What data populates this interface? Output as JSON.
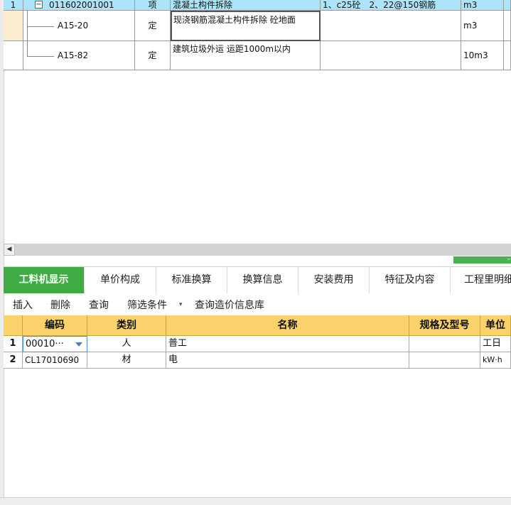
{
  "top_grid": {
    "rows": [
      {
        "num": "1",
        "code": "011602001001",
        "type": "项",
        "name": "混凝土构件拆除",
        "feature": "1、c25砼　2、22@150钢筋",
        "unit": "m3"
      },
      {
        "num": "",
        "code": "A15-20",
        "type": "定",
        "name": "现浇钢筋混凝土构件拆除 砼地面",
        "feature": "",
        "unit": "m3"
      },
      {
        "num": "",
        "code": "A15-82",
        "type": "定",
        "name": "建筑垃圾外运 运距1000m以内",
        "feature": "",
        "unit": "10m3"
      }
    ],
    "expand_symbol": "−"
  },
  "hscroll": {
    "left_arrow": "◀"
  },
  "splitter": {
    "arrow": "⌄"
  },
  "tabs": [
    {
      "label": "工料机显示",
      "active": true
    },
    {
      "label": "单价构成"
    },
    {
      "label": "标准换算"
    },
    {
      "label": "换算信息"
    },
    {
      "label": "安装费用"
    },
    {
      "label": "特征及内容"
    },
    {
      "label": "工程里明细"
    }
  ],
  "toolbar": {
    "insert": "插入",
    "delete": "删除",
    "query": "查询",
    "filter": "筛选条件",
    "filter_caret": "▾",
    "price_db": "查询造价信息库"
  },
  "bottom_grid": {
    "headers": {
      "code": "编码",
      "category": "类别",
      "name": "名称",
      "spec": "规格及型号",
      "unit": "单位"
    },
    "rows": [
      {
        "num": "1",
        "code": "00010···",
        "category": "人",
        "name": "普工",
        "spec": "",
        "unit": "工日"
      },
      {
        "num": "2",
        "code": "CL17010690",
        "category": "材",
        "name": "电",
        "spec": "",
        "unit": "kW·h"
      }
    ]
  },
  "colors": {
    "row_highlight": "#aee4f9",
    "tab_active": "#3fab45",
    "header_bg": "#f9d26b"
  }
}
